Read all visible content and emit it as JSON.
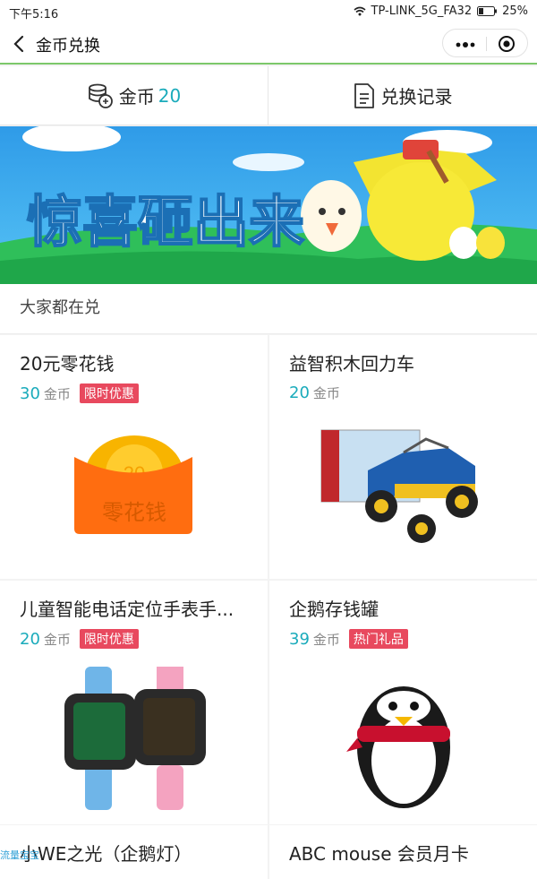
{
  "status_bar": {
    "time": "下午5:16",
    "wifi_name": "TP-LINK_5G_FA32",
    "battery": "25%"
  },
  "nav": {
    "title": "金币兑换"
  },
  "tabs": {
    "coins_label": "金币",
    "coins_value": "20",
    "records_label": "兑换记录"
  },
  "banner": {
    "text": "惊喜砸出来"
  },
  "section": {
    "title": "大家都在兑"
  },
  "products": [
    {
      "name": "20元零花钱",
      "price": "30",
      "unit": "金币",
      "badge": "限时优惠",
      "image_text": "零花钱",
      "coin_text": "20"
    },
    {
      "name": "益智积木回力车",
      "price": "20",
      "unit": "金币",
      "badge": ""
    },
    {
      "name": "儿童智能电话定位手表手...",
      "price": "20",
      "unit": "金币",
      "badge": "限时优惠"
    },
    {
      "name": "企鹅存钱罐",
      "price": "39",
      "unit": "金币",
      "badge": "热门礼品"
    },
    {
      "name": "小WE之光（企鹅灯）"
    },
    {
      "name": "ABC mouse 会员月卡"
    }
  ],
  "watermark": "流量宝宝",
  "colors": {
    "accent": "#1aabbb",
    "badge": "#e8495e",
    "nav_border": "#7cc86a"
  }
}
